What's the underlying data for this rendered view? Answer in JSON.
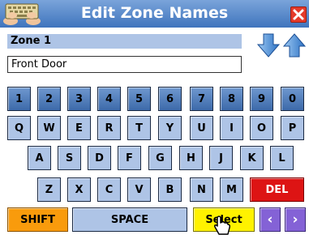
{
  "titlebar": {
    "title": "Edit Zone Names",
    "close_icon": "close-icon",
    "keyboard_icon": "keyboard-icon"
  },
  "zone": {
    "label": "Zone 1",
    "name_value": "Front Door"
  },
  "nav_arrows": {
    "down_icon": "arrow-down-icon",
    "up_icon": "arrow-up-icon"
  },
  "keyboard": {
    "number_row": [
      "1",
      "2",
      "3",
      "4",
      "5",
      "6",
      "7",
      "8",
      "9",
      "0"
    ],
    "row1": [
      "Q",
      "W",
      "E",
      "R",
      "T",
      "Y",
      "U",
      "I",
      "O",
      "P"
    ],
    "row2": [
      "A",
      "S",
      "D",
      "F",
      "G",
      "H",
      "J",
      "K",
      "L"
    ],
    "row3": [
      "Z",
      "X",
      "C",
      "V",
      "B",
      "N",
      "M"
    ],
    "del": "DEL",
    "shift": "SHIFT",
    "space": "SPACE",
    "select": "Select",
    "left": "‹",
    "right": "›"
  },
  "colors": {
    "titlebar": "#4a7fc4",
    "key_blue": "#aec4e6",
    "num_key": "#4b78b8",
    "del": "#dd1414",
    "shift": "#f99b0c",
    "select": "#fff200",
    "nav": "#8462d6"
  }
}
